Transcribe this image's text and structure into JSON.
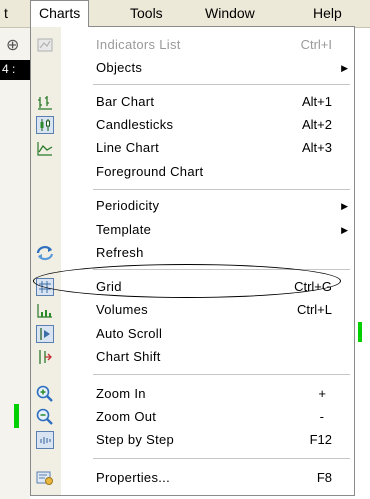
{
  "menubar": {
    "items": [
      {
        "label": "t"
      },
      {
        "label": "Charts"
      },
      {
        "label": "Tools"
      },
      {
        "label": "Window"
      },
      {
        "label": "Help"
      }
    ]
  },
  "background": {
    "toolbar_fragment": "4 :"
  },
  "menu": {
    "items": [
      {
        "label": "Indicators List",
        "shortcut": "Ctrl+I",
        "icon": "indicators-list-icon",
        "disabled": true
      },
      {
        "label": "Objects",
        "submenu": true
      },
      {
        "label": "Bar Chart",
        "shortcut": "Alt+1",
        "icon": "bar-chart-icon"
      },
      {
        "label": "Candlesticks",
        "shortcut": "Alt+2",
        "icon": "candlesticks-icon",
        "checked": true
      },
      {
        "label": "Line Chart",
        "shortcut": "Alt+3",
        "icon": "line-chart-icon"
      },
      {
        "label": "Foreground Chart"
      },
      {
        "label": "Periodicity",
        "submenu": true
      },
      {
        "label": "Template",
        "submenu": true
      },
      {
        "label": "Refresh",
        "icon": "refresh-icon"
      },
      {
        "label": "Grid",
        "shortcut": "Ctrl+G",
        "icon": "grid-icon",
        "checked": true
      },
      {
        "label": "Volumes",
        "shortcut": "Ctrl+L",
        "icon": "volumes-icon"
      },
      {
        "label": "Auto Scroll",
        "icon": "auto-scroll-icon",
        "checked": true
      },
      {
        "label": "Chart Shift",
        "icon": "chart-shift-icon"
      },
      {
        "label": "Zoom In",
        "shortcut": "+",
        "icon": "zoom-in-icon"
      },
      {
        "label": "Zoom Out",
        "shortcut": "-",
        "icon": "zoom-out-icon"
      },
      {
        "label": "Step by Step",
        "shortcut": "F12",
        "icon": "step-by-step-icon"
      },
      {
        "label": "Properties...",
        "shortcut": "F8",
        "icon": "properties-icon"
      }
    ]
  },
  "colors": {
    "menubar_bg": "#ece9d8",
    "icon_strip_bg": "#f1efe4",
    "accent_blue": "#3a6ea5",
    "chart_green": "#00d000",
    "disabled_text": "#9a9a9a"
  }
}
